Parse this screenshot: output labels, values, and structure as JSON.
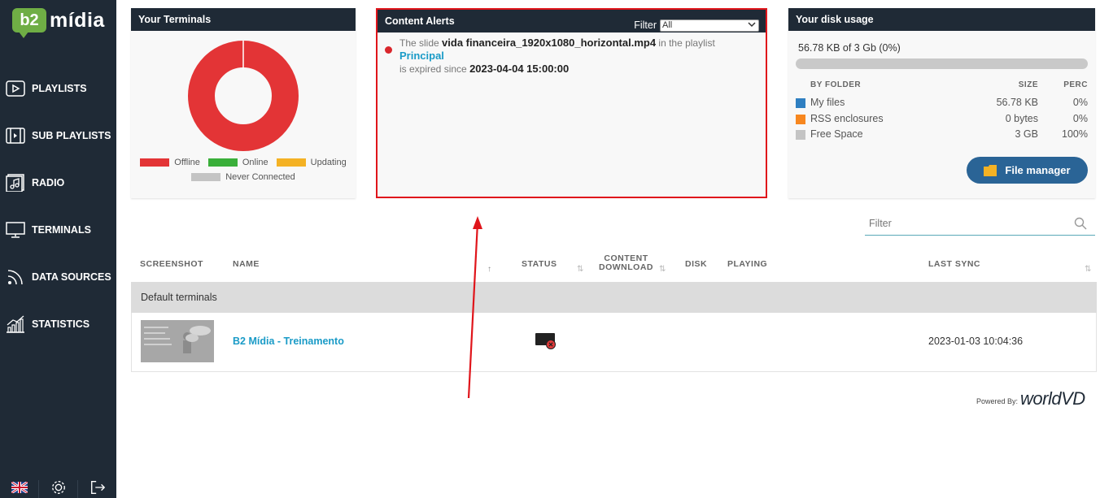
{
  "logo": {
    "badge": "b2",
    "text": "mídia"
  },
  "sidebar": {
    "items": [
      {
        "label": "PLAYLISTS",
        "icon": "play-icon"
      },
      {
        "label": "SUB PLAYLISTS",
        "icon": "sub-playlist-icon"
      },
      {
        "label": "RADIO",
        "icon": "music-note-icon"
      },
      {
        "label": "TERMINALS",
        "icon": "monitor-icon"
      },
      {
        "label": "DATA SOURCES",
        "icon": "rss-icon"
      },
      {
        "label": "STATISTICS",
        "icon": "bar-chart-icon"
      }
    ],
    "bottom": [
      "uk-flag-icon",
      "gear-icon",
      "logout-icon"
    ]
  },
  "terminals_card": {
    "title": "Your Terminals",
    "legend": {
      "offline": "Offline",
      "online": "Online",
      "updating": "Updating",
      "never": "Never Connected"
    },
    "colors": {
      "offline": "#e33436",
      "online": "#3aaf3a",
      "updating": "#f4b224",
      "never": "#c4c4c4"
    },
    "chart_values": {
      "offline": 1,
      "online": 0,
      "updating": 0,
      "never": 0
    }
  },
  "alerts_card": {
    "title": "Content Alerts",
    "filter_label": "Filter",
    "filter_value": "All",
    "alert": {
      "prefix": "The slide",
      "slide": "vida financeira_1920x1080_horizontal.mp4",
      "middle": "in the playlist",
      "playlist": "Principal",
      "suffix": "is expired since",
      "date": "2023-04-04 15:00:00"
    }
  },
  "disk_card": {
    "title": "Your disk usage",
    "total": "56.78 KB of 3 Gb (0%)",
    "usage_fraction": 0.0,
    "headers": {
      "folder": "BY FOLDER",
      "size": "SIZE",
      "perc": "PERC"
    },
    "rows": [
      {
        "name": "My files",
        "size": "56.78 KB",
        "perc": "0%",
        "color": "#2f7fc1"
      },
      {
        "name": "RSS enclosures",
        "size": "0 bytes",
        "perc": "0%",
        "color": "#f7871f"
      },
      {
        "name": "Free Space",
        "size": "3 GB",
        "perc": "100%",
        "color": "#c4c4c4"
      }
    ],
    "button": "File manager"
  },
  "table": {
    "filter_placeholder": "Filter",
    "headers": {
      "screenshot": "SCREENSHOT",
      "name": "NAME",
      "status": "STATUS",
      "content_download_1": "CONTENT",
      "content_download_2": "DOWNLOAD",
      "disk": "DISK",
      "playing": "PLAYING",
      "last_sync": "LAST SYNC"
    },
    "group": "Default terminals",
    "rows": [
      {
        "name": "B2 Mídia - Treinamento",
        "status": "offline",
        "last_sync": "2023-01-03 10:04:36"
      }
    ]
  },
  "footer": {
    "powered_by": "Powered By:",
    "brand": "worldVD"
  }
}
